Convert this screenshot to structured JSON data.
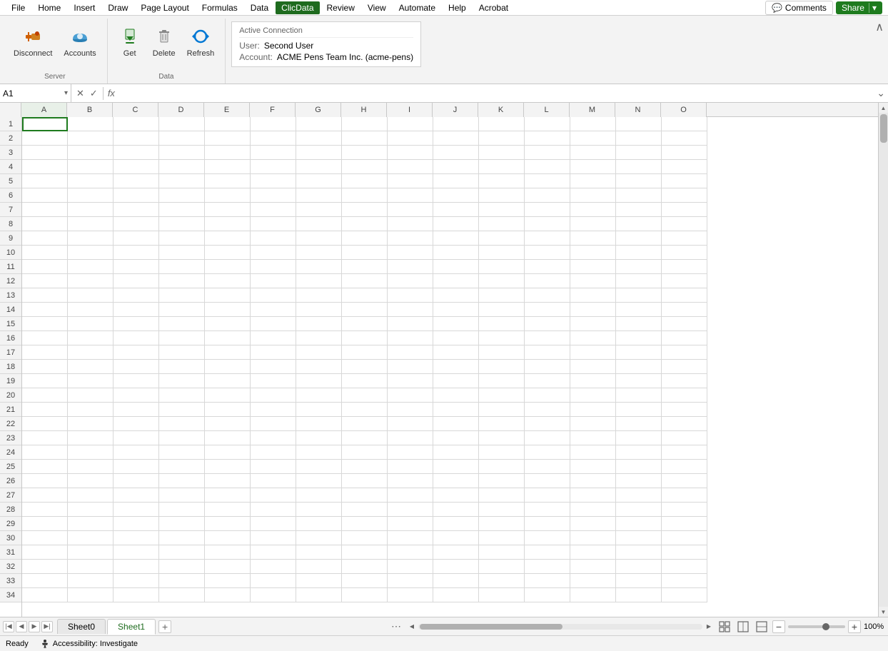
{
  "menubar": {
    "items": [
      {
        "id": "file",
        "label": "File"
      },
      {
        "id": "home",
        "label": "Home"
      },
      {
        "id": "insert",
        "label": "Insert"
      },
      {
        "id": "draw",
        "label": "Draw"
      },
      {
        "id": "page-layout",
        "label": "Page Layout"
      },
      {
        "id": "formulas",
        "label": "Formulas"
      },
      {
        "id": "data",
        "label": "Data"
      },
      {
        "id": "clicdata",
        "label": "ClicData",
        "active": true
      },
      {
        "id": "review",
        "label": "Review"
      },
      {
        "id": "view",
        "label": "View"
      },
      {
        "id": "automate",
        "label": "Automate"
      },
      {
        "id": "help",
        "label": "Help"
      },
      {
        "id": "acrobat",
        "label": "Acrobat"
      }
    ],
    "comments_label": "Comments",
    "share_label": "Share"
  },
  "ribbon": {
    "groups": [
      {
        "id": "server",
        "label": "Server",
        "buttons": [
          {
            "id": "disconnect",
            "label": "Disconnect",
            "icon": "🔌"
          },
          {
            "id": "accounts",
            "label": "Accounts",
            "icon": "☁"
          }
        ]
      },
      {
        "id": "data",
        "label": "Data",
        "buttons": [
          {
            "id": "get",
            "label": "Get",
            "icon": "↓"
          },
          {
            "id": "delete",
            "label": "Delete",
            "icon": "🗑"
          },
          {
            "id": "refresh",
            "label": "Refresh",
            "icon": "↻"
          }
        ]
      }
    ],
    "active_connection": {
      "title": "Active Connection",
      "user_label": "User:",
      "user_value": "Second User",
      "account_label": "Account:",
      "account_value": "ACME Pens Team Inc. (acme-pens)"
    }
  },
  "formula_bar": {
    "cell_ref": "A1",
    "formula_value": "",
    "fx_label": "fx"
  },
  "spreadsheet": {
    "columns": [
      "A",
      "B",
      "C",
      "D",
      "E",
      "F",
      "G",
      "H",
      "I",
      "J",
      "K",
      "L",
      "M",
      "N",
      "O"
    ],
    "rows": [
      1,
      2,
      3,
      4,
      5,
      6,
      7,
      8,
      9,
      10,
      11,
      12,
      13,
      14,
      15,
      16,
      17,
      18,
      19,
      20,
      21,
      22,
      23,
      24,
      25,
      26,
      27,
      28,
      29,
      30,
      31,
      32,
      33,
      34
    ],
    "selected_cell": "A1"
  },
  "sheets": {
    "tabs": [
      {
        "id": "sheet0",
        "label": "Sheet0",
        "active": false
      },
      {
        "id": "sheet1",
        "label": "Sheet1",
        "active": true
      }
    ]
  },
  "status_bar": {
    "ready_label": "Ready",
    "accessibility_label": "Accessibility: Investigate",
    "zoom_value": "100%"
  }
}
